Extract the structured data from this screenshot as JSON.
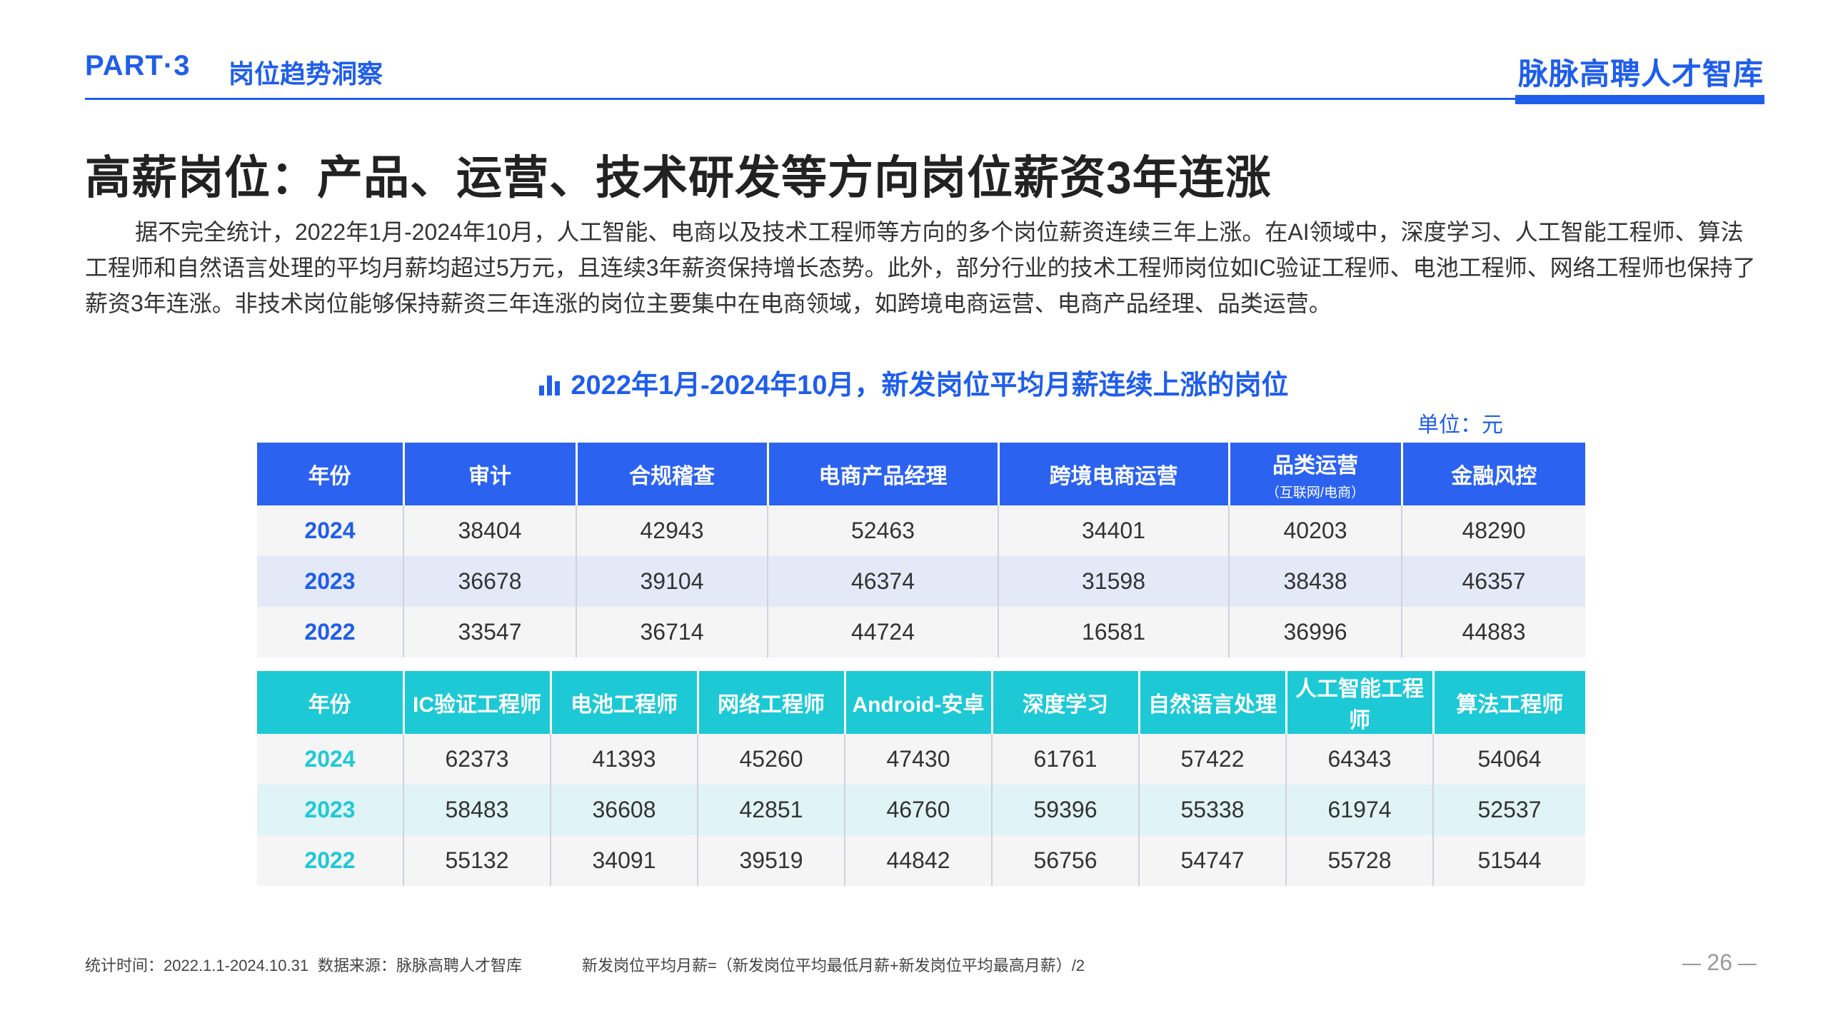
{
  "header": {
    "part": "PART·3",
    "section": "岗位趋势洞察",
    "brand": "脉脉高聘人才智库"
  },
  "title": "高薪岗位：产品、运营、技术研发等方向岗位薪资3年连涨",
  "paragraph": "据不完全统计，2022年1月-2024年10月，人工智能、电商以及技术工程师等方向的多个岗位薪资连续三年上涨。在AI领域中，深度学习、人工智能工程师、算法工程师和自然语言处理的平均月薪均超过5万元，且连续3年薪资保持增长态势。此外，部分行业的技术工程师岗位如IC验证工程师、电池工程师、网络工程师也保持了薪资3年连涨。非技术岗位能够保持薪资三年连涨的岗位主要集中在电商领域，如跨境电商运营、电商产品经理、品类运营。",
  "chart": {
    "heading": "2022年1月-2024年10月，新发岗位平均月薪连续上涨的岗位",
    "heading_icon": "bar-chart-icon",
    "unit": "单位：元"
  },
  "table1": {
    "headers": [
      "年份",
      "审计",
      "合规稽查",
      "电商产品经理",
      "跨境电商运营",
      "品类运营",
      "金融风控"
    ],
    "header_sub": "（互联网/电商）",
    "rows": [
      [
        "2024",
        "38404",
        "42943",
        "52463",
        "34401",
        "40203",
        "48290"
      ],
      [
        "2023",
        "36678",
        "39104",
        "46374",
        "31598",
        "38438",
        "46357"
      ],
      [
        "2022",
        "33547",
        "36714",
        "44724",
        "16581",
        "36996",
        "44883"
      ]
    ]
  },
  "table2": {
    "headers": [
      "年份",
      "IC验证工程师",
      "电池工程师",
      "网络工程师",
      "Android-安卓",
      "深度学习",
      "自然语言处理",
      "人工智能工程师",
      "算法工程师"
    ],
    "rows": [
      [
        "2024",
        "62373",
        "41393",
        "45260",
        "47430",
        "61761",
        "57422",
        "64343",
        "54064"
      ],
      [
        "2023",
        "58483",
        "36608",
        "42851",
        "46760",
        "59396",
        "55338",
        "61974",
        "52537"
      ],
      [
        "2022",
        "55132",
        "34091",
        "39519",
        "44842",
        "56756",
        "54747",
        "55728",
        "51544"
      ]
    ]
  },
  "footer": {
    "stat_time": "统计时间：2022.1.1-2024.10.31",
    "source": "数据来源：脉脉高聘人才智库",
    "formula": "新发岗位平均月薪=（新发岗位平均最低月薪+新发岗位平均最高月薪）/2",
    "page": "26"
  },
  "colors": {
    "primary_blue": "#1f5eea",
    "table1_header": "#2b62f0",
    "table2_header": "#1ec9d6"
  }
}
